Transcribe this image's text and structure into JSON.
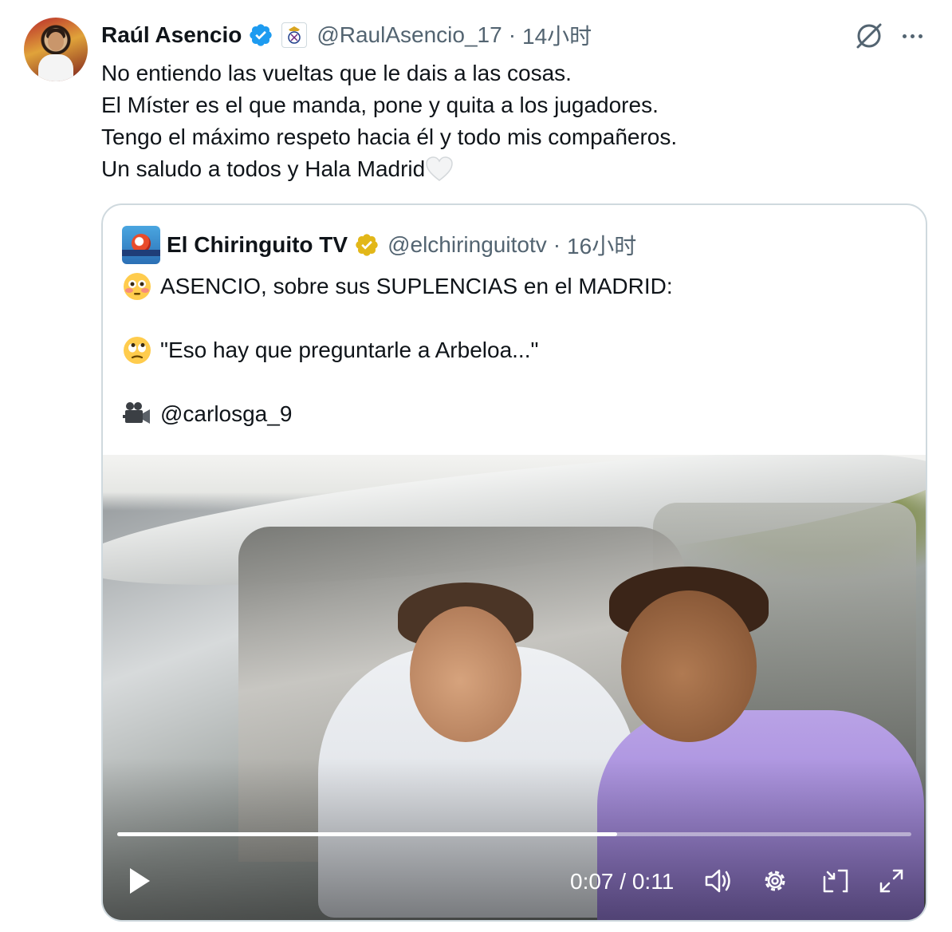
{
  "tweet": {
    "author_name": "Raúl Asencio",
    "handle": "@RaulAsencio_17",
    "separator": "·",
    "time": "14小时",
    "lines": [
      "No entiendo las vueltas que le dais a las cosas.",
      "El Míster es el que manda, pone y quita a los jugadores.",
      "Tengo el máximo respeto hacia él y todo mis compañeros.",
      "Un saludo a todos y Hala Madrid"
    ],
    "icons": [
      "verified-blue-icon",
      "real-madrid-badge-icon",
      "grok-icon",
      "more-icon",
      "white-heart-emoji"
    ]
  },
  "quote": {
    "author_name": "El Chiringuito TV",
    "handle": "@elchiringuitotv",
    "separator": "·",
    "time": "16小时",
    "lines": [
      "ASENCIO, sobre sus SUPLENCIAS en el MADRID:",
      "\"Eso hay que preguntarle a Arbeloa...\"",
      "@carlosga_9"
    ],
    "icons": [
      "verified-gold-icon",
      "flushed-face-emoji",
      "rolling-eyes-emoji",
      "video-camera-emoji"
    ]
  },
  "video": {
    "current_time": "0:07",
    "time_divider": "/",
    "duration": "0:11",
    "progress_fraction": 0.63,
    "colors": {
      "progress_bg": "#ffffff73",
      "progress_fill": "#ffffff"
    }
  },
  "colors": {
    "text": "#0f1419",
    "secondary": "#536471",
    "border": "#cfd9de",
    "verified_blue": "#1d9bf0",
    "verified_gold": "#e2b719"
  }
}
